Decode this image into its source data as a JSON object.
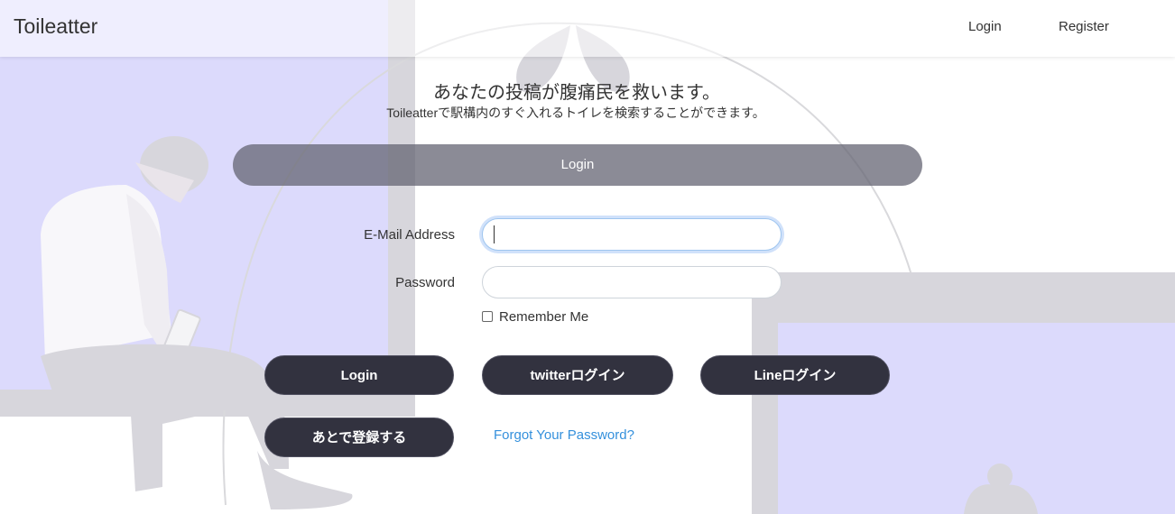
{
  "navbar": {
    "brand": "Toileatter",
    "links": {
      "login": "Login",
      "register": "Register"
    }
  },
  "hero": {
    "headline": "あなたの投稿が腹痛民を救います。",
    "subline": "Toileatterで駅構内のすぐ入れるトイレを検索することができます。"
  },
  "form": {
    "header": "Login",
    "email_label": "E-Mail Address",
    "email_value": "",
    "password_label": "Password",
    "password_value": "",
    "remember_label": "Remember Me",
    "remember_checked": false,
    "buttons": {
      "login": "Login",
      "twitter": "twitterログイン",
      "line": "Lineログイン",
      "later": "あとで登録する"
    },
    "forgot_link": "Forgot Your Password?"
  },
  "colors": {
    "accent_purple": "#dcdafc",
    "button_dark": "#32323f",
    "link_blue": "#3490dc"
  }
}
